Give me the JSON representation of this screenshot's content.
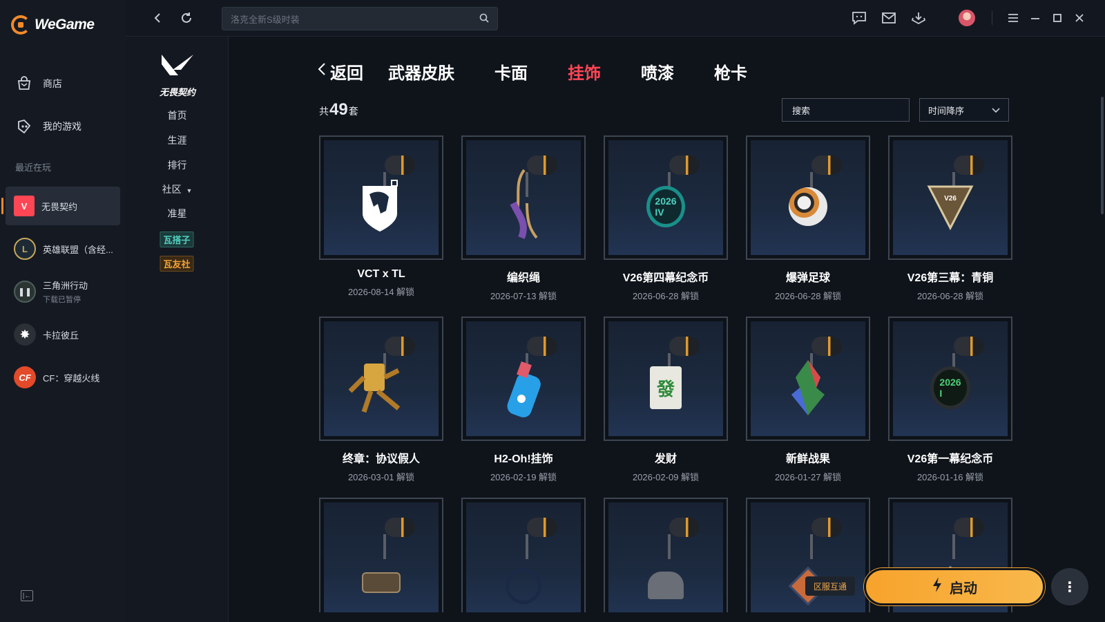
{
  "app": {
    "name": "WeGame"
  },
  "sidebar": {
    "nav": [
      {
        "label": "商店",
        "icon": "bag-icon"
      },
      {
        "label": "我的游戏",
        "icon": "gamepad-icon"
      }
    ],
    "recent_title": "最近在玩",
    "games": [
      {
        "name": "无畏契约",
        "sub": "",
        "icon": "valorant-icon",
        "color": "#ff4655",
        "active": true
      },
      {
        "name": "英雄联盟（含经...",
        "sub": "",
        "icon": "lol-icon",
        "color": "#c8a85a"
      },
      {
        "name": "三角洲行动",
        "sub": "下载已暂停",
        "icon": "pause-icon",
        "color": "#3a4a48"
      },
      {
        "name": "卡拉彼丘",
        "sub": "",
        "icon": "strinova-icon",
        "color": "#e8e8e8"
      },
      {
        "name": "CF：穿越火线",
        "sub": "",
        "icon": "cf-icon",
        "color": "#e24a2a"
      }
    ]
  },
  "topbar": {
    "search_placeholder": "洛克全新S级时装"
  },
  "gamenav": {
    "logo_text": "无畏契约",
    "items": [
      "首页",
      "生涯",
      "排行",
      "社区",
      "准星"
    ],
    "badges": [
      {
        "label": "瓦搭子",
        "color": "#4fd0c0"
      },
      {
        "label": "瓦友社",
        "color": "#f2a33a"
      }
    ]
  },
  "main": {
    "back_label": "返回",
    "tabs": [
      {
        "label": "武器皮肤",
        "active": false
      },
      {
        "label": "卡面",
        "active": false
      },
      {
        "label": "挂饰",
        "active": true
      },
      {
        "label": "喷漆",
        "active": false
      },
      {
        "label": "枪卡",
        "active": false
      }
    ],
    "count_prefix": "共",
    "count": "49",
    "count_suffix": "套",
    "search_label": "搜索",
    "sort_label": "时间降序"
  },
  "items": [
    {
      "name": "VCT x TL",
      "date": "2026-08-14 解锁",
      "charm": "horse"
    },
    {
      "name": "编织绳",
      "date": "2026-07-13 解锁",
      "charm": "rope"
    },
    {
      "name": "V26第四幕纪念币",
      "date": "2026-06-28 解锁",
      "charm": "coin-teal"
    },
    {
      "name": "爆弹足球",
      "date": "2026-06-28 解锁",
      "charm": "ball"
    },
    {
      "name": "V26第三幕：青铜",
      "date": "2026-06-28 解锁",
      "charm": "triangle"
    },
    {
      "name": "终章：协议假人",
      "date": "2026-03-01 解锁",
      "charm": "dummy"
    },
    {
      "name": "H2-Oh!挂饰",
      "date": "2026-02-19 解锁",
      "charm": "bottle"
    },
    {
      "name": "发财",
      "date": "2026-02-09 解锁",
      "charm": "mahjong"
    },
    {
      "name": "新鲜战果",
      "date": "2026-01-27 解锁",
      "charm": "leaf"
    },
    {
      "name": "V26第一幕纪念币",
      "date": "2026-01-16 解锁",
      "charm": "coin-green"
    },
    {
      "name": "",
      "date": "",
      "charm": "badge"
    },
    {
      "name": "",
      "date": "",
      "charm": "ring"
    },
    {
      "name": "",
      "date": "",
      "charm": "creature"
    },
    {
      "name": "",
      "date": "",
      "charm": "card"
    },
    {
      "name": "",
      "date": "",
      "charm": "tag"
    }
  ],
  "bottom": {
    "region_label": "区服互通",
    "launch_label": "启动"
  },
  "colors": {
    "accent": "#ff4655",
    "brand": "#f28a2a",
    "launch": "#f7a32c"
  }
}
